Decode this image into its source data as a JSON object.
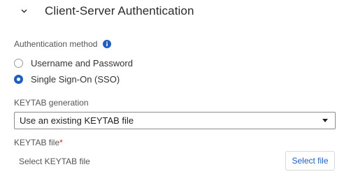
{
  "section": {
    "title": "Client-Server Authentication",
    "chevron_icon": "chevron-down-icon"
  },
  "auth_method": {
    "label": "Authentication method",
    "info_icon": "info-icon",
    "options": [
      {
        "label": "Username and Password",
        "selected": false
      },
      {
        "label": "Single Sign-On (SSO)",
        "selected": true
      }
    ]
  },
  "keytab_generation": {
    "label": "KEYTAB generation",
    "selected_value": "Use an existing KEYTAB file",
    "caret_icon": "caret-down-icon"
  },
  "keytab_file": {
    "label": "KEYTAB file",
    "required_marker": "*",
    "placeholder": "Select KEYTAB file",
    "button_label": "Select file"
  },
  "colors": {
    "accent": "#1f5fbf",
    "required": "#cc2b2b",
    "text": "#333333"
  }
}
